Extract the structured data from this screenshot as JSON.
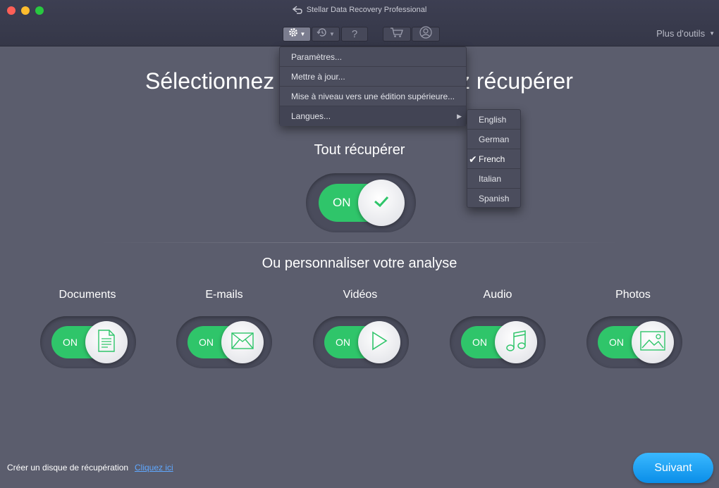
{
  "window": {
    "title": "Stellar Data Recovery Professional",
    "more_tools": "Plus d'outils"
  },
  "toolbar": {
    "help": "?"
  },
  "main": {
    "heading_left": "Sélectionnez",
    "heading_right": "z récupérer",
    "recover_all": "Tout récupérer",
    "customize": "Ou personnaliser votre analyse",
    "toggle_on": "ON"
  },
  "categories": [
    {
      "label": "Documents",
      "icon": "document-icon",
      "state": "ON"
    },
    {
      "label": "E-mails",
      "icon": "envelope-icon",
      "state": "ON"
    },
    {
      "label": "Vidéos",
      "icon": "play-icon",
      "state": "ON"
    },
    {
      "label": "Audio",
      "icon": "music-note-icon",
      "state": "ON"
    },
    {
      "label": "Photos",
      "icon": "image-icon",
      "state": "ON"
    }
  ],
  "settings_menu": {
    "items": [
      {
        "label": "Paramètres..."
      },
      {
        "label": "Mettre à jour..."
      },
      {
        "label": "Mise à niveau vers une édition supérieure..."
      },
      {
        "label": "Langues..."
      }
    ]
  },
  "language_menu": {
    "items": [
      "English",
      "German",
      "French",
      "Italian",
      "Spanish"
    ],
    "selected": "French"
  },
  "footer": {
    "text": "Créer un disque de récupération",
    "link": "Cliquez ici",
    "next": "Suivant"
  },
  "colors": {
    "background": "#5b5d6d",
    "toggle_on": "#2fc56a",
    "accent_blue": "#0a8ee8"
  }
}
